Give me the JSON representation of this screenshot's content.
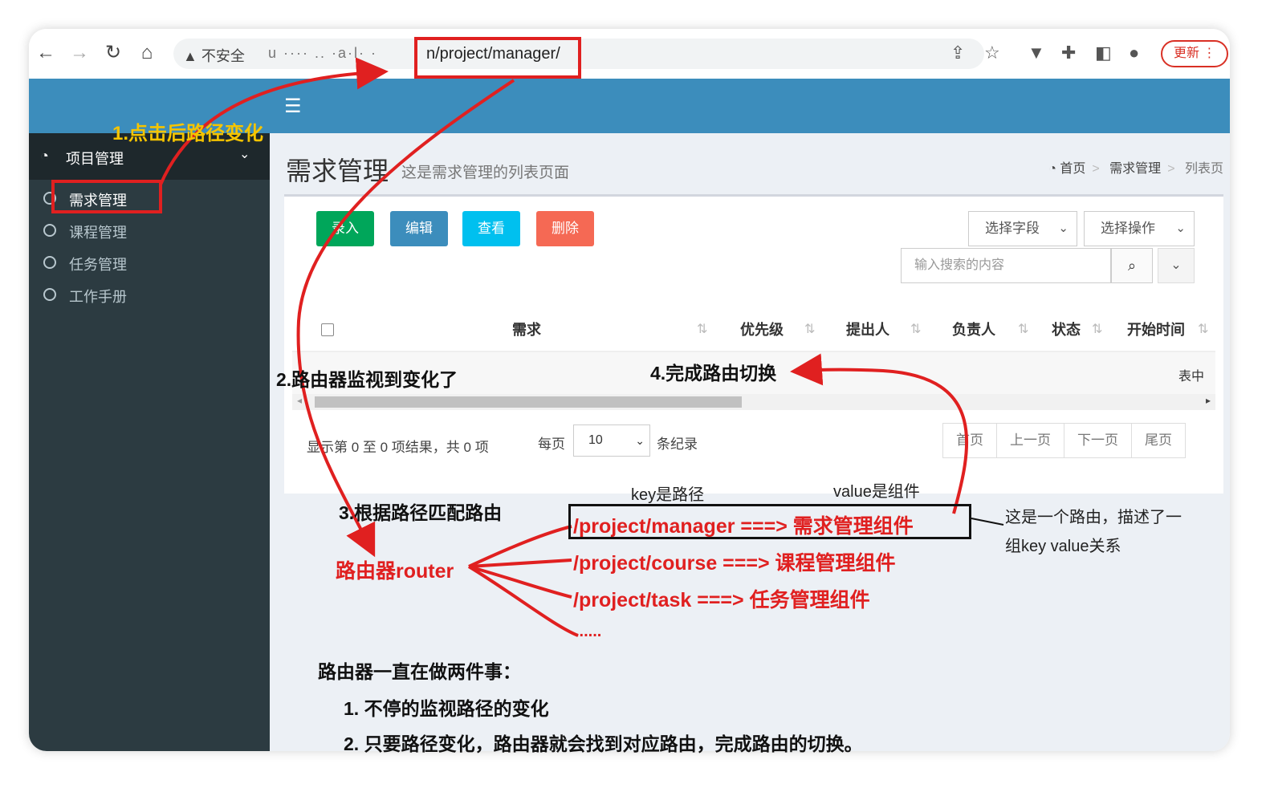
{
  "browser": {
    "insecure_label": "不安全",
    "url_blurred": "u  ···· ..  ·a·l· ·",
    "url_path": "n/project/manager/",
    "update_label": "更新"
  },
  "sidebar": {
    "header_label": "项目管理",
    "items": [
      {
        "label": "需求管理"
      },
      {
        "label": "课程管理"
      },
      {
        "label": "任务管理"
      },
      {
        "label": "工作手册"
      }
    ]
  },
  "content": {
    "title": "需求管理",
    "subtitle": "这是需求管理的列表页面",
    "breadcrumb": {
      "home": "首页",
      "section": "需求管理",
      "page": "列表页"
    },
    "buttons": {
      "add": "录入",
      "edit": "编辑",
      "view": "查看",
      "delete": "删除"
    },
    "select_field": "选择字段",
    "select_action": "选择操作",
    "search_placeholder": "输入搜索的内容",
    "table": {
      "columns": [
        "需求",
        "优先级",
        "提出人",
        "负责人",
        "状态",
        "开始时间"
      ],
      "empty_text": "表中"
    },
    "footer": {
      "info": "显示第 0 至 0 项结果，共 0 项",
      "per_page_label": "每页",
      "per_page_value": "10",
      "per_page_suffix": "条纪录",
      "pager": [
        "首页",
        "上一页",
        "下一页",
        "尾页"
      ]
    }
  },
  "annotations": {
    "step1": "1.点击后路径变化",
    "step2": "2.路由器监视到变化了",
    "step3": "3.根据路径匹配路由",
    "step4": "4.完成路由切换",
    "key_label": "key是路径",
    "value_label": "value是组件",
    "router_label": "路由器router",
    "routes": [
      "/project/manager ===> 需求管理组件",
      "/project/course ===> 课程管理组件",
      "/project/task ===> 任务管理组件",
      "......"
    ],
    "route_note_line1": "这是一个路由，描述了一",
    "route_note_line2": "组key value关系",
    "summary_title": "路由器一直在做两件事：",
    "summary_1": "1. 不停的监视路径的变化",
    "summary_2": "2. 只要路径变化，路由器就会找到对应路由，完成路由的切换。"
  },
  "colors": {
    "accent_blue": "#3c8dbc",
    "sidebar_bg": "#2c3b41",
    "annotation_red": "#e02020",
    "annotation_yellow": "#f5c400"
  }
}
